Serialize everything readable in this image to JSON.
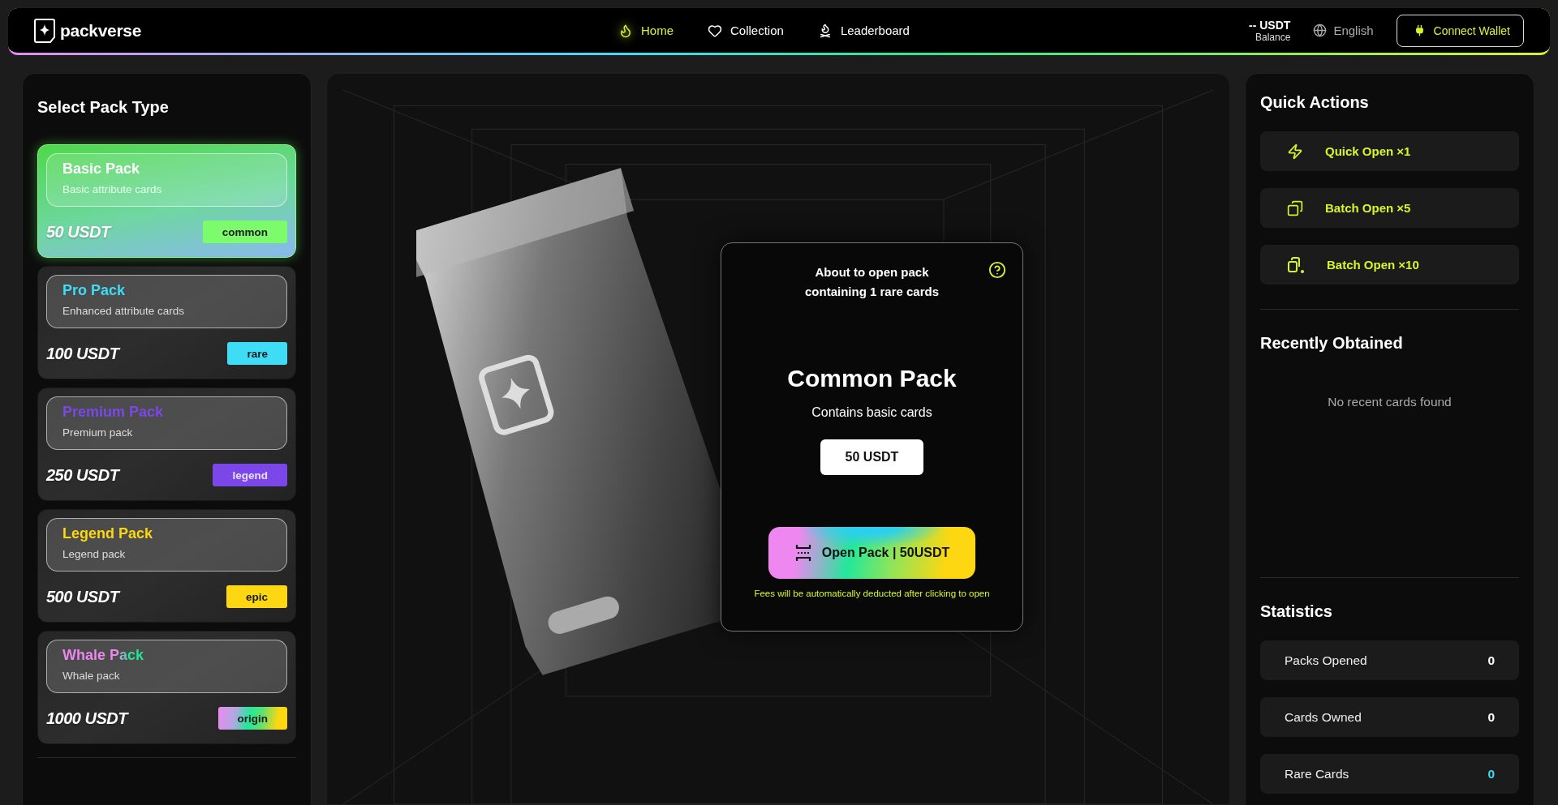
{
  "header": {
    "logo": "packverse",
    "nav": [
      {
        "label": "Home",
        "selected": true
      },
      {
        "label": "Collection",
        "selected": false
      },
      {
        "label": "Leaderboard",
        "selected": false
      }
    ],
    "balance": {
      "amount": "-- USDT",
      "label": "Balance"
    },
    "language": "English",
    "connect_button": "Connect Wallet"
  },
  "pack_panel": {
    "title": "Select Pack Type",
    "packs": [
      {
        "name": "Basic Pack",
        "description": "Basic attribute cards",
        "price": "50 USDT",
        "tag": "common",
        "selected": true,
        "kind": "solid",
        "color": "#7cfc6c"
      },
      {
        "name": "Pro Pack",
        "description": "Enhanced attribute cards",
        "price": "100 USDT",
        "tag": "rare",
        "selected": false,
        "kind": "solid",
        "color": "#3fdcf5"
      },
      {
        "name": "Premium Pack",
        "description": "Premium pack",
        "price": "250 USDT",
        "tag": "legend",
        "selected": false,
        "kind": "solid",
        "color": "#7b47e8"
      },
      {
        "name": "Legend Pack",
        "description": "Legend pack",
        "price": "500 USDT",
        "tag": "epic",
        "selected": false,
        "kind": "solid",
        "color": "#fcd712"
      },
      {
        "name": "Whale Pack",
        "description": "Whale pack",
        "price": "1000 USDT",
        "tag": "origin",
        "selected": false,
        "kind": "rainbow"
      }
    ]
  },
  "pack_preview": {
    "notice": "About to open pack containing 1 rare cards",
    "name": "Common Pack",
    "description": "Contains basic cards",
    "price": "50 USDT",
    "open_button": "Open Pack | 50USDT",
    "fee_note": "Fees will be automatically deducted after clicking to open"
  },
  "quick_actions": {
    "title": "Quick Actions",
    "actions": [
      {
        "label": "Quick Open ×1",
        "kind": "single"
      },
      {
        "label": "Batch Open ×5",
        "kind": "batch"
      },
      {
        "label": "Batch Open ×10",
        "kind": "bulk"
      }
    ]
  },
  "recently_obtained": {
    "title": "Recently Obtained",
    "empty": "No recent cards found"
  },
  "statistics": {
    "title": "Statistics",
    "rows": [
      {
        "label": "Packs Opened",
        "value": "0",
        "highlight": false
      },
      {
        "label": "Cards Owned",
        "value": "0",
        "highlight": false
      },
      {
        "label": "Rare Cards",
        "value": "0",
        "highlight": true
      }
    ]
  }
}
